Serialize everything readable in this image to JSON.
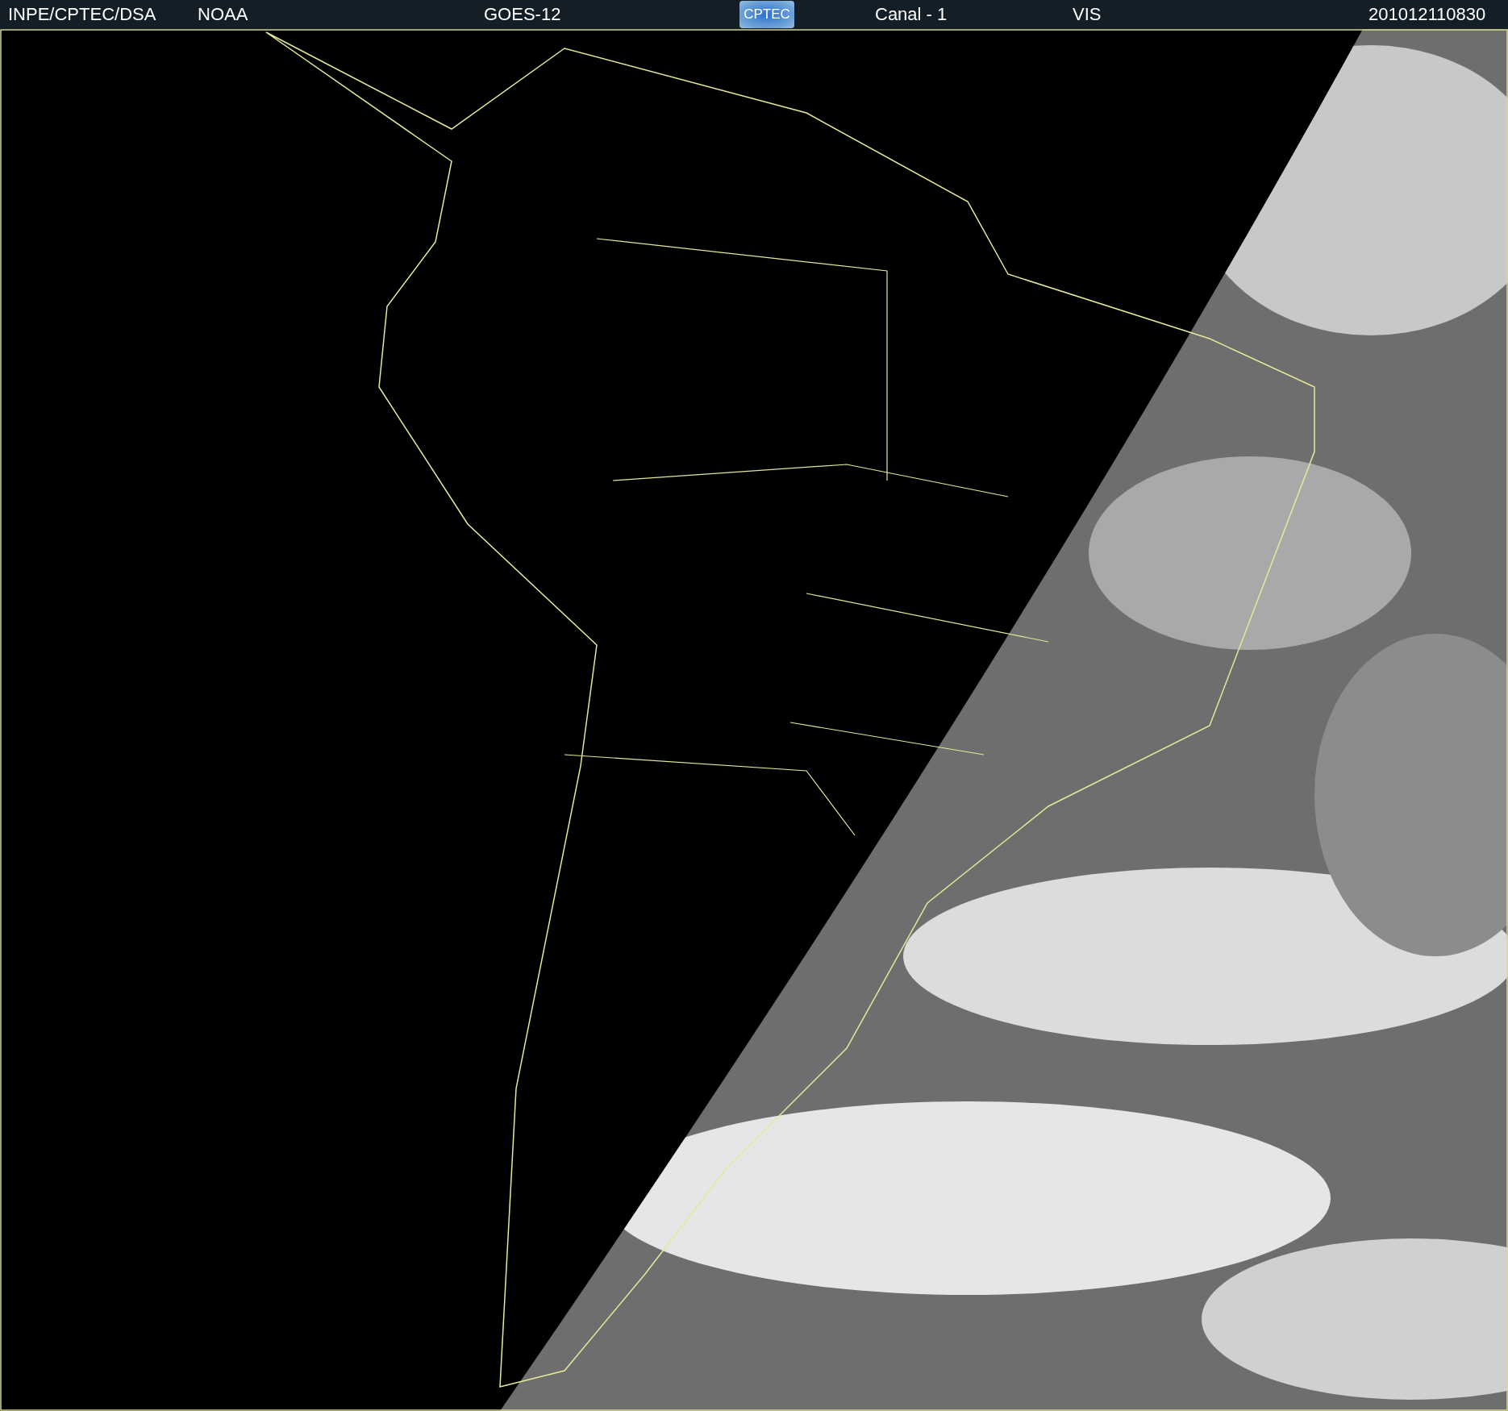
{
  "header": {
    "items": [
      {
        "kind": "text",
        "text": "INPE/CPTEC/DSA"
      },
      {
        "kind": "text",
        "text": "NOAA"
      },
      {
        "kind": "text",
        "text": "GOES-12"
      },
      {
        "kind": "logo",
        "text": "CPTEC"
      },
      {
        "kind": "text",
        "text": "Canal - 1"
      },
      {
        "kind": "text",
        "text": "VIS"
      },
      {
        "kind": "text",
        "text": "201012110830"
      }
    ]
  }
}
